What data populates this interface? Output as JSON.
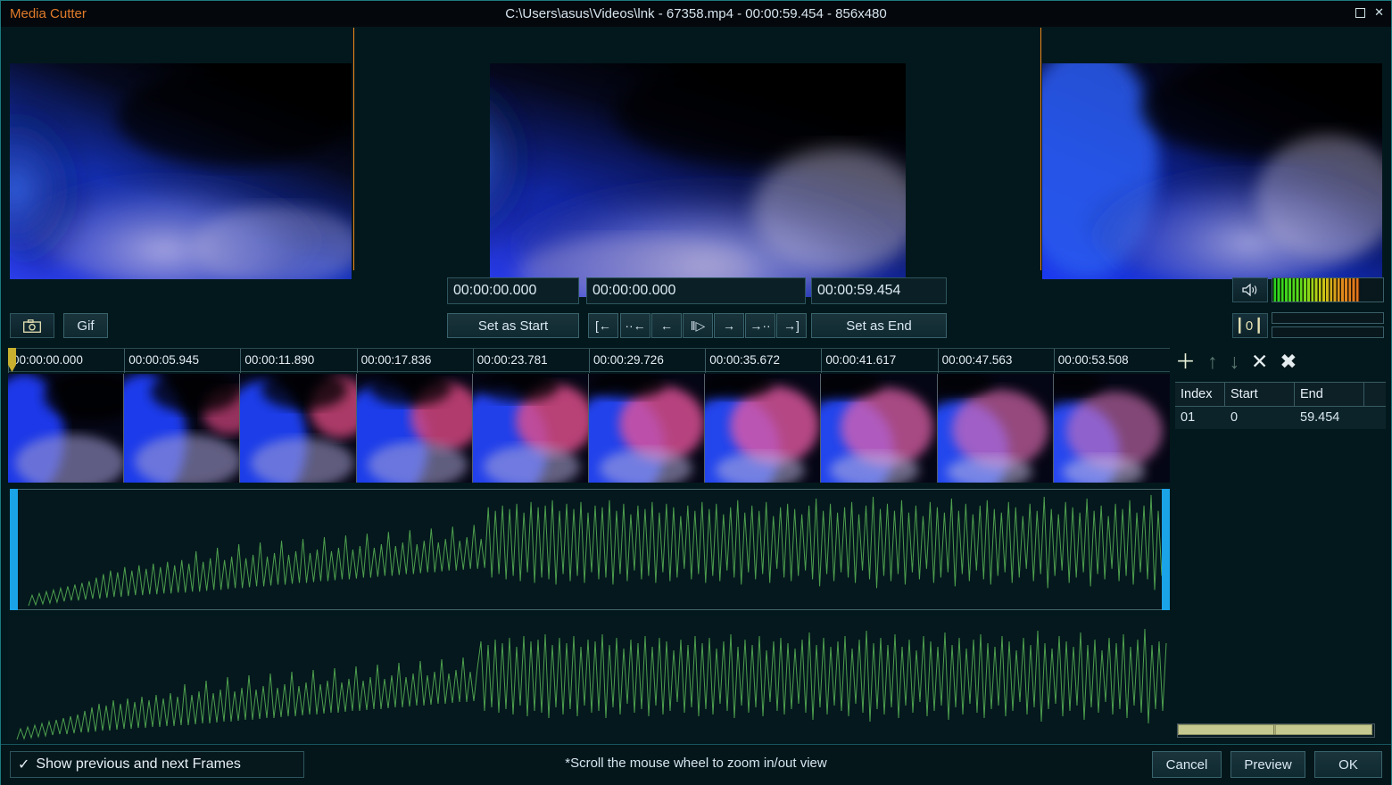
{
  "window": {
    "app_name": "Media Cutter",
    "title": "C:\\Users\\asus\\Videos\\lnk - 67358.mp4 - 00:00:59.454 - 856x480",
    "maximize_icon": "maximize-icon",
    "close_label": "✕"
  },
  "preview": {
    "pane_prev_label": "previous-frame-preview",
    "pane_current_label": "current-frame-preview",
    "pane_next_label": "next-frame-preview"
  },
  "transport": {
    "start_time": "00:00:00.000",
    "current_time": "00:00:00.000",
    "end_time": "00:00:59.454",
    "set_as_start": "Set as Start",
    "set_as_end": "Set as End",
    "nav_buttons": [
      {
        "name": "jump-to-start-button",
        "label": "[←"
      },
      {
        "name": "prev-keyframe-button",
        "label": "··←"
      },
      {
        "name": "prev-frame-button",
        "label": "←"
      },
      {
        "name": "play-pause-button",
        "label": "‖▷"
      },
      {
        "name": "next-frame-button",
        "label": "→"
      },
      {
        "name": "next-keyframe-button",
        "label": "→··"
      },
      {
        "name": "jump-to-end-button",
        "label": "→]"
      }
    ],
    "snapshot_icon": "camera-icon",
    "gif_label": "Gif"
  },
  "audio": {
    "speaker_icon": "speaker-icon",
    "level_label": "0",
    "meter_percent": 79,
    "meter_colors": [
      "#27d21f",
      "#c6cf15",
      "#e0701c"
    ]
  },
  "timeline": {
    "ticks": [
      "00:00:00.000",
      "00:00:05.945",
      "00:00:11.890",
      "00:00:17.836",
      "00:00:23.781",
      "00:00:29.726",
      "00:00:35.672",
      "00:00:41.617",
      "00:00:47.563",
      "00:00:53.508"
    ],
    "playhead_position": "00:00:00.000",
    "selection_color": "#1ba3e8"
  },
  "clips_panel": {
    "toolbar": [
      {
        "name": "add-clip-button",
        "label": "＋",
        "color": "#e9f1d9",
        "enabled": true
      },
      {
        "name": "move-up-button",
        "label": "↑",
        "color": "#5c7a72",
        "enabled": false
      },
      {
        "name": "move-down-button",
        "label": "↓",
        "color": "#5c7a72",
        "enabled": false
      },
      {
        "name": "delete-clip-button",
        "label": "✕",
        "color": "#e4ecef",
        "enabled": true
      },
      {
        "name": "delete-all-clips-button",
        "label": "✖",
        "color": "#e4ecef",
        "enabled": true
      }
    ],
    "columns": [
      "Index",
      "Start",
      "End"
    ],
    "rows": [
      {
        "index": "01",
        "start": "0",
        "end": "59.454"
      }
    ],
    "scrollbar_grip": "‖‖"
  },
  "footer": {
    "show_frames_checked": true,
    "show_frames_check": "✓",
    "show_frames_label": "Show previous and next Frames",
    "hint": "*Scroll the mouse wheel to zoom in/out view",
    "cancel_label": "Cancel",
    "preview_label": "Preview",
    "ok_label": "OK"
  }
}
